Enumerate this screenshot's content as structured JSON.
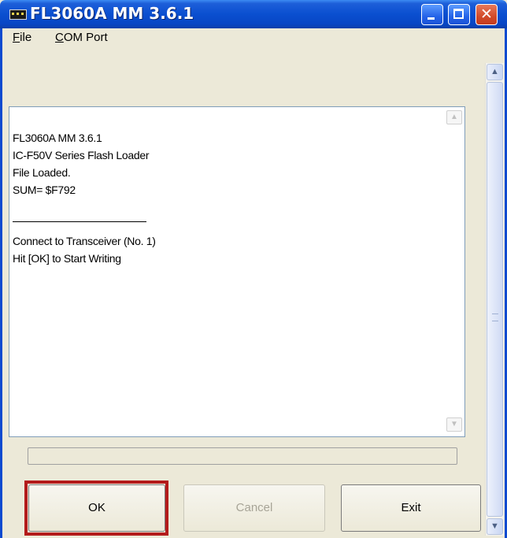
{
  "window": {
    "title": "FL3060A MM 3.6.1",
    "close_glyph": "✕",
    "icons": {
      "app": "chip-icon",
      "minimize": "minimize-icon",
      "maximize": "maximize-icon",
      "close": "close-icon"
    }
  },
  "menu": {
    "file": {
      "accel": "F",
      "rest": "ile"
    },
    "com_port": {
      "accel": "C",
      "rest": "OM Port"
    }
  },
  "log": {
    "lines": [
      "FL3060A MM 3.6.1",
      "IC-F50V Series Flash Loader",
      "File Loaded.",
      "SUM= $F792",
      "Connect to Transceiver (No. 1)",
      "Hit [OK] to Start Writing"
    ]
  },
  "progress": {
    "value_percent": 0
  },
  "buttons": {
    "ok": "OK",
    "cancel": "Cancel",
    "exit": "Exit"
  },
  "scroll": {
    "up_arrow": "▲",
    "down_arrow": "▼"
  },
  "colors": {
    "titlebar": "#0a4fd0",
    "highlight": "#b31b1b",
    "window_bg": "#ece9d8"
  }
}
